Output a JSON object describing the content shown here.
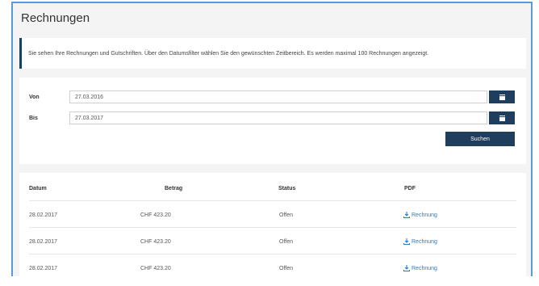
{
  "page": {
    "title": "Rechnungen",
    "info_text": "Sie sehen Ihre Rechnungen und Gutschriften. Über den Datumsfilter wählen Sie den gewünschten Zeitbereich. Es werden maximal 100 Rechnungen angezeigt."
  },
  "filter": {
    "from_label": "Von",
    "from_value": "27.03.2016",
    "to_label": "Bis",
    "to_value": "27.03.2017",
    "search_label": "Suchen",
    "calendar_icon": "calendar-icon"
  },
  "table": {
    "headers": {
      "date": "Datum",
      "amount": "Betrag",
      "status": "Status",
      "pdf": "PDF"
    },
    "rows": [
      {
        "date": "28.02.2017",
        "amount": "CHF 423.20",
        "status": "Offen",
        "pdf": "Rechnung"
      },
      {
        "date": "28.02.2017",
        "amount": "CHF 423.20",
        "status": "Offen",
        "pdf": "Rechnung"
      },
      {
        "date": "28.02.2017",
        "amount": "CHF 423.20",
        "status": "Offen",
        "pdf": "Rechnung"
      }
    ]
  },
  "colors": {
    "accent": "#1f3d5c",
    "link": "#2a7bc8",
    "frame": "#5b9bd5"
  }
}
